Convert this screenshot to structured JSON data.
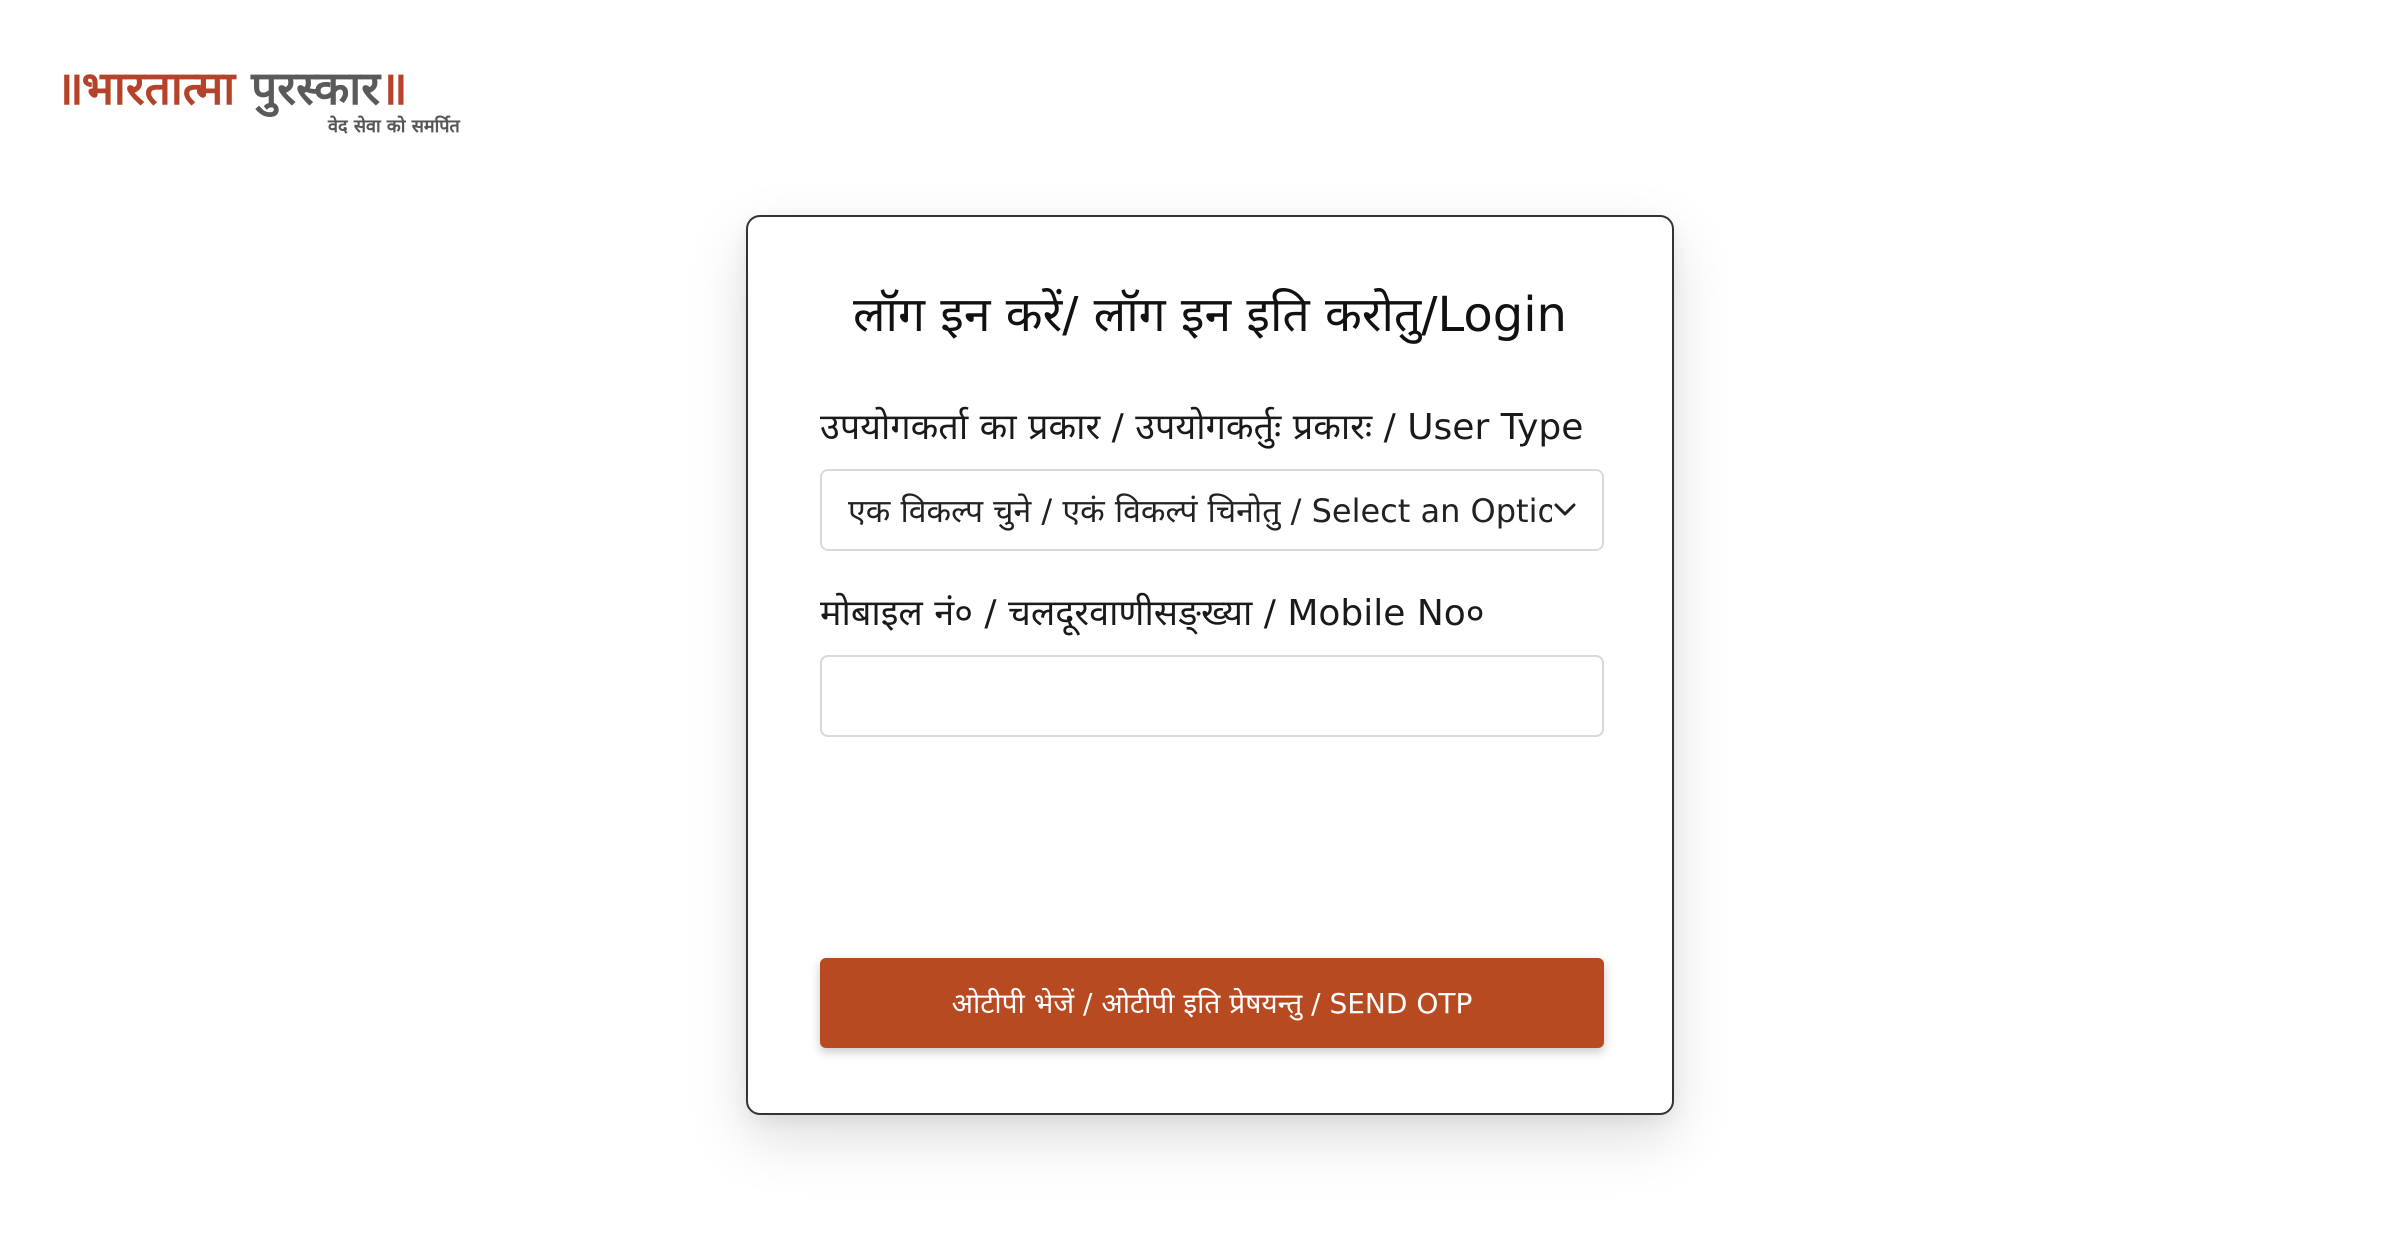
{
  "logo": {
    "bars_left": "॥",
    "word_1": "भारतात्मा",
    "word_2": "पुरस्कार",
    "bars_right": "॥",
    "tagline": "वेद सेवा को समर्पित"
  },
  "login_card": {
    "title": "लॉग इन करें/ लॉग इन इति करोतु/Login",
    "user_type": {
      "label": "उपयोगकर्ता का प्रकार / उपयोगकर्तुः प्रकारः / User Type",
      "selected_value": "एक विकल्प चुने / एकं विकल्पं चिनोतु / Select an Option"
    },
    "mobile": {
      "label": "मोबाइल नं० / चलदूरवाणीसङ्ख्या / Mobile No०",
      "value": "",
      "placeholder": ""
    },
    "send_otp_label": "ओटीपी भेजें / ओटीपी इति प्रेषयन्तु / SEND OTP"
  },
  "colors": {
    "brand": "#b84a22",
    "logo_red": "#b5432a",
    "logo_gray": "#5a5a5a"
  }
}
